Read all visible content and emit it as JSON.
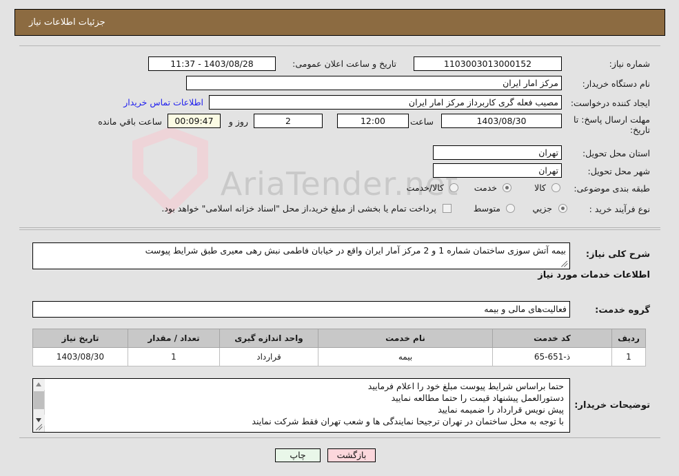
{
  "header": {
    "title": "جزئیات اطلاعات نیاز"
  },
  "watermark": {
    "text": "AriaTender.net"
  },
  "form": {
    "need_number_label": "شماره نیاز:",
    "need_number_value": "1103003013000152",
    "announce_label": "تاریخ و ساعت اعلان عمومی:",
    "announce_value": "1403/08/28 - 11:37",
    "buyer_org_label": "نام دستگاه خریدار:",
    "buyer_org_value": "مرکز امار ایران",
    "creator_label": "ایجاد کننده درخواست:",
    "creator_value": "مصیب فعله گری کاربرداز مرکز امار ایران",
    "contact_link": "اطلاعات تماس خریدار",
    "deadline_label": "مهلت ارسال پاسخ: تا تاریخ:",
    "deadline_date": "1403/08/30",
    "time_label": "ساعت",
    "time_value": "12:00",
    "days_value": "2",
    "days_unit": "روز و",
    "countdown_value": "00:09:47",
    "countdown_unit": "ساعت باقي مانده",
    "province_label": "استان محل تحویل:",
    "province_value": "تهران",
    "city_label": "شهر محل تحویل:",
    "city_value": "تهران",
    "category_label": "طبقه بندی موضوعی:",
    "category_options": [
      "کالا",
      "خدمت",
      "کالا/خدمت"
    ],
    "category_selected": "خدمت",
    "process_label": "نوع فرآیند خرید :",
    "process_options": [
      "جزیي",
      "متوسط"
    ],
    "process_selected": "جزیي",
    "treasury_checkbox_label": "پرداخت تمام یا بخشی از مبلغ خرید،از محل \"اسناد خزانه اسلامی\" خواهد بود.",
    "treasury_checked": false
  },
  "description": {
    "label": "شرح کلی نیاز:",
    "value": "بیمه آتش سوزی ساختمان شماره 1 و 2 مرکز آمار ایران واقع در خیابان فاطمی نبش رهی معیری طبق شرایط پیوست"
  },
  "service_section": {
    "title": "اطلاعات خدمات مورد نیاز",
    "group_label": "گروه خدمت:",
    "group_value": "فعالیت‌های مالی و بیمه"
  },
  "table": {
    "columns": [
      "ردیف",
      "کد خدمت",
      "نام خدمت",
      "واحد اندازه گیری",
      "تعداد / مقدار",
      "تاریخ نیاز"
    ],
    "rows": [
      {
        "row": "1",
        "code": "ذ-651-65",
        "name": "بیمه",
        "unit": "قرارداد",
        "qty": "1",
        "date": "1403/08/30"
      }
    ]
  },
  "notes": {
    "label": "توضیحات خریدار:",
    "lines": [
      "حتما براساس شرایط پیوست  مبلغ خود را اعلام فرمایید",
      "دستورالعمل پیشنهاد قیمت را حتما مطالعه نمایید",
      "پیش نویس قرارداد را ضمیمه نمایید",
      "با توجه به محل ساختمان در تهران ترجیحا نمایندگی ها و شعب تهران فقط شرکت نمایند"
    ]
  },
  "footer": {
    "back_label": "بازگشت",
    "print_label": "چاپ"
  },
  "colors": {
    "header_bar": "#8c6b41",
    "page_bg": "#e3e3e3",
    "link": "#2020ee",
    "back_button": "#fcd7dc",
    "print_button": "#e9f7e9",
    "countdown_field": "#fbfbe4",
    "table_header": "#c8c8c8"
  }
}
